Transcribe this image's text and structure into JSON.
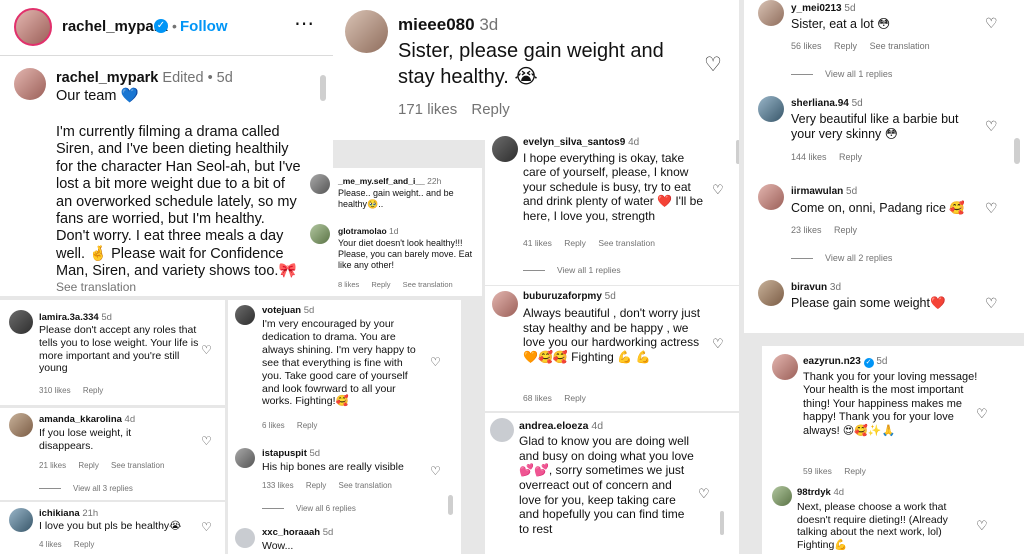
{
  "p1": {
    "header_user": "rachel_mypark",
    "dot": "•",
    "follow": "Follow",
    "more": "⋯",
    "post_user": "rachel_mypark",
    "edited": "Edited",
    "sep": "•",
    "post_time": "5d",
    "post_line1": "Our team 💙",
    "post_body": "I'm currently filming a drama called Siren, and I've been dieting healthily for the character Han Seol-ah, but I've lost a bit more weight due to a bit of an overworked schedule lately, so my fans are worried, but I'm healthy. Don't worry. I eat three meals a day well. 🤞 Please wait for Confidence Man, Siren, and variety shows too.🎀",
    "see_translation": "See translation"
  },
  "p2": {
    "user": "mieee080",
    "time": "3d",
    "text": "Sister, please gain weight and stay healthy. 😭",
    "likes": "171 likes",
    "reply": "Reply"
  },
  "p3": {
    "c1_user": "_me_my.self_and_i__",
    "c1_time": "22h",
    "c1_text": "Please.. gain weight.. and be healthy🥹..",
    "c2_user": "glotramolao",
    "c2_time": "1d",
    "c2_text": "Your diet doesn't look healthy!!! Please, you can barely move. Eat like any other!",
    "c2_likes": "8 likes",
    "c2_reply": "Reply",
    "c2_see": "See translation"
  },
  "p4": {
    "user": "lamira.3a.334",
    "time": "5d",
    "text": "Please don't accept any roles that tells you to lose weight. Your life is more important and you're still young",
    "likes": "310 likes",
    "reply": "Reply"
  },
  "p5": {
    "user": "amanda_kkarolina",
    "time": "4d",
    "text": "If you lose weight, it disappears.",
    "likes": "21 likes",
    "reply": "Reply",
    "see": "See translation",
    "view_all": "View all 3 replies"
  },
  "p6": {
    "user": "ichikiana",
    "time": "21h",
    "text": "I love you but pls be healthy😭",
    "likes": "4 likes",
    "reply": "Reply"
  },
  "p7": {
    "c1_user": "votejuan",
    "c1_time": "5d",
    "c1_text": "I'm very encouraged by your dedication to drama. You are always shining. I'm very happy to see that everything is fine with you. Take good care of yourself and look fowrward to all your works. Fighting!🥰",
    "c1_likes": "6 likes",
    "c1_reply": "Reply",
    "c2_user": "istapuspit",
    "c2_time": "5d",
    "c2_text": "His hip bones are really visible",
    "c2_likes": "133 likes",
    "c2_reply": "Reply",
    "c2_see": "See translation",
    "view_all": "View all 6 replies",
    "c3_user": "xxc_horaaah",
    "c3_time": "5d",
    "c3_text": "Wow..."
  },
  "p8": {
    "user": "evelyn_silva_santos9",
    "time": "4d",
    "text": "I hope everything is okay, take care of yourself, please, I know your schedule is busy, try to eat and drink plenty of water ❤️ I'll be here, I love you, strength",
    "likes": "41 likes",
    "reply": "Reply",
    "see": "See translation",
    "view_all": "View all 1 replies"
  },
  "p9": {
    "user": "buburuzaforpmy",
    "time": "5d",
    "text": "Always beautiful , don't worry just stay healthy and be happy , we love you our hardworking actress 🧡🥰🥰 Fighting 💪 💪",
    "likes": "68 likes",
    "reply": "Reply"
  },
  "p10": {
    "user": "andrea.eloeza",
    "time": "4d",
    "text": "Glad to know you are doing well and busy on doing what you love 💕💕, sorry sometimes we just overreact out of concern and love for you, keep taking care and hopefully you can find time to rest"
  },
  "p11": {
    "c1_user": "y_mei0213",
    "c1_time": "5d",
    "c1_text": "Sister, eat a lot 😳",
    "c1_likes": "56 likes",
    "c1_reply": "Reply",
    "c1_see": "See translation",
    "c1_view": "View all 1 replies",
    "c2_user": "sherliana.94",
    "c2_time": "5d",
    "c2_text": "Very beautiful like a barbie but your very skinny 😳",
    "c2_likes": "144 likes",
    "c2_reply": "Reply",
    "c3_user": "iirmawulan",
    "c3_time": "5d",
    "c3_text": "Come on, onni, Padang rice 🥰",
    "c3_likes": "23 likes",
    "c3_reply": "Reply",
    "c3_view": "View all 2 replies",
    "c4_user": "biravun",
    "c4_time": "3d",
    "c4_text": "Please gain some weight❤️"
  },
  "p12": {
    "c1_user": "eazyrun.n23",
    "c1_time": "5d",
    "c1_text": "Thank you for your loving message! Your health is the most important thing! Your happiness makes me happy! Thank you for your love always! 😍🥰✨🙏",
    "c1_likes": "59 likes",
    "c1_reply": "Reply",
    "c2_user": "98trdyk",
    "c2_time": "4d",
    "c2_text": "Next, please choose a work that doesn't require dieting!! (Already talking about the next work, lol) Fighting💪"
  },
  "colors": {
    "accent": "#0095f6",
    "muted": "#737373"
  }
}
